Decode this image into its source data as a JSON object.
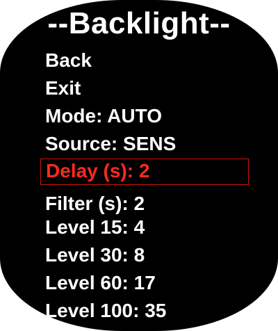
{
  "screen": {
    "title": "--Backlight--",
    "colors": {
      "background": "#000000",
      "text": "#ffffff",
      "selected_text": "#ff2a1f",
      "selected_border": "#d01010"
    }
  },
  "menu": {
    "items": [
      {
        "label": "Back"
      },
      {
        "label": "Exit"
      },
      {
        "label": "Mode: AUTO"
      },
      {
        "label": "Source: SENS"
      },
      {
        "label": "Delay (s): 2",
        "selected": true
      },
      {
        "label": "Filter (s): 2"
      },
      {
        "label": "Level 15: 4"
      },
      {
        "label": "Level 30: 8"
      },
      {
        "label": "Level 60: 17"
      },
      {
        "label": "Level 100: 35"
      }
    ]
  }
}
